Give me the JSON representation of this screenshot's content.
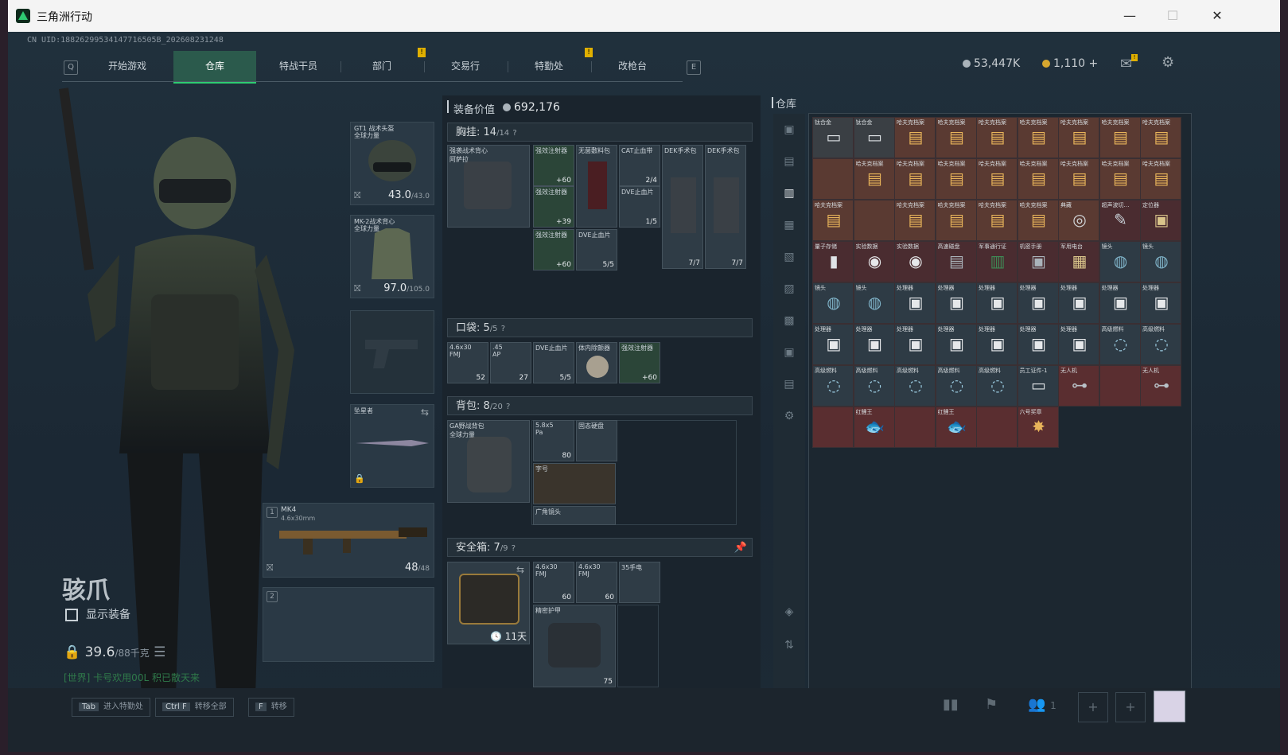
{
  "window": {
    "title": "三角洲行动",
    "min": "—",
    "max": "☐",
    "close": "✕"
  },
  "uid": "CN UID:18826299534147716505B_202608231248",
  "nav": {
    "left_key": "Q",
    "right_key": "E",
    "tabs": [
      "开始游戏",
      "仓库",
      "特战干员",
      "部门",
      "交易行",
      "特勤处",
      "改枪台"
    ],
    "active": 1,
    "badge": "!"
  },
  "currency": {
    "silver": "53,447K",
    "gold": "1,110",
    "plus": "+"
  },
  "operator": {
    "name": "骇爪",
    "show_equipment": "显示装备",
    "weight": "39.6",
    "weight_max": "/88千克",
    "chat": "[世界] 卡号欢用00L 积已散天来"
  },
  "equip": {
    "helmet": {
      "label": "GT1 战术头盔\n全球力量",
      "val": "43.0",
      "max": "/43.0"
    },
    "armor": {
      "label": "MK-2战术背心\n全球力量",
      "val": "97.0",
      "max": "/105.0"
    },
    "melee": {
      "label": "坠星者"
    },
    "primary": {
      "num": "1",
      "label": "MK4",
      "sub": "4.6x30mm",
      "val": "48",
      "max": "/48"
    },
    "secondary": {
      "num": "2"
    }
  },
  "mid": {
    "value_label": "装备价值",
    "value": "692,176",
    "chest": {
      "label": "胸挂:",
      "count": "14",
      "max": "/14",
      "help": "?"
    },
    "pockets": {
      "label": "口袋:",
      "count": "5",
      "max": "/5",
      "help": "?"
    },
    "backpack": {
      "label": "背包:",
      "count": "8",
      "max": "/20",
      "help": "?"
    },
    "safe": {
      "label": "安全箱:",
      "count": "7",
      "max": "/9",
      "help": "?",
      "days": "11天"
    },
    "chest_items": [
      {
        "l": "强袭战术背心\n阿萨拉",
        "n": ""
      },
      {
        "l": "强效注射器",
        "n": "+60"
      },
      {
        "l": "无菌敷料包",
        "n": ""
      },
      {
        "l": "CAT止血带",
        "n": "2/4"
      },
      {
        "l": "DEK手术包",
        "n": "7/7"
      },
      {
        "l": "DEK手术包",
        "n": "7/7"
      },
      {
        "l": "强效注射器",
        "n": "+39"
      },
      {
        "l": "DVE止血片",
        "n": "1/5"
      },
      {
        "l": "强效注射器",
        "n": "+60"
      },
      {
        "l": "DVE止血片",
        "n": "5/5"
      }
    ],
    "pocket_items": [
      {
        "l": "4.6x30\nFMJ",
        "n": "52"
      },
      {
        "l": ".45\nAP",
        "n": "27"
      },
      {
        "l": "DVE止血片",
        "n": "5/5"
      },
      {
        "l": "体内除颤器",
        "n": ""
      },
      {
        "l": "强效注射器",
        "n": "+60"
      }
    ],
    "backpack_items": [
      {
        "l": "GA野战背包\n全球力量",
        "n": ""
      },
      {
        "l": "5.8x5\nPa",
        "n": "80"
      },
      {
        "l": "固态硬盘",
        "n": ""
      },
      {
        "l": "字号",
        "n": ""
      },
      {
        "l": "广角镜头",
        "n": ""
      }
    ],
    "safe_items": [
      {
        "l": "4.6x30\nFMJ",
        "n": "60"
      },
      {
        "l": "4.6x30\nFMJ",
        "n": "60"
      },
      {
        "l": "35手电",
        "n": ""
      },
      {
        "l": "精密护甲",
        "n": "75"
      }
    ]
  },
  "storage": {
    "label": "仓库",
    "items": [
      {
        "l": "钛合金",
        "s": "▭",
        "c": "#3a3f44",
        "t": "#dfe3e6"
      },
      {
        "l": "钛合金",
        "s": "▭",
        "c": "#3a3f44",
        "t": "#dfe3e6"
      },
      {
        "l": "哈夫克档案",
        "s": "▤",
        "c": "#5a3a32",
        "t": "#e8b45a"
      },
      {
        "l": "哈夫克档案",
        "s": "▤",
        "c": "#5a3a32",
        "t": "#e8b45a"
      },
      {
        "l": "哈夫克档案",
        "s": "▤",
        "c": "#5a3a32",
        "t": "#e8b45a"
      },
      {
        "l": "哈夫克档案",
        "s": "▤",
        "c": "#5a3a32",
        "t": "#e8b45a"
      },
      {
        "l": "哈夫克档案",
        "s": "▤",
        "c": "#5a3a32",
        "t": "#e8b45a"
      },
      {
        "l": "哈夫克档案",
        "s": "▤",
        "c": "#5a3a32",
        "t": "#e8b45a"
      },
      {
        "l": "哈夫克档案",
        "s": "▤",
        "c": "#5a3a32",
        "t": "#e8b45a"
      },
      {
        "l": "",
        "s": "",
        "c": "#5a3a32",
        "t": "#e8b45a"
      },
      {
        "l": "哈夫克档案",
        "s": "▤",
        "c": "#5a3a32",
        "t": "#e8b45a"
      },
      {
        "l": "哈夫克档案",
        "s": "▤",
        "c": "#5a3a32",
        "t": "#e8b45a"
      },
      {
        "l": "哈夫克档案",
        "s": "▤",
        "c": "#5a3a32",
        "t": "#e8b45a"
      },
      {
        "l": "哈夫克档案",
        "s": "▤",
        "c": "#5a3a32",
        "t": "#e8b45a"
      },
      {
        "l": "哈夫克档案",
        "s": "▤",
        "c": "#5a3a32",
        "t": "#e8b45a"
      },
      {
        "l": "哈夫克档案",
        "s": "▤",
        "c": "#5a3a32",
        "t": "#e8b45a"
      },
      {
        "l": "哈夫克档案",
        "s": "▤",
        "c": "#5a3a32",
        "t": "#e8b45a"
      },
      {
        "l": "哈夫克档案",
        "s": "▤",
        "c": "#5a3a32",
        "t": "#e8b45a"
      },
      {
        "l": "哈夫克档案",
        "s": "▤",
        "c": "#5a3a32",
        "t": "#e8b45a"
      },
      {
        "l": "",
        "s": "",
        "c": "#5a3a32",
        "t": "#e8b45a"
      },
      {
        "l": "哈夫克档案",
        "s": "▤",
        "c": "#5a3a32",
        "t": "#e8b45a"
      },
      {
        "l": "哈夫克档案",
        "s": "▤",
        "c": "#5a3a32",
        "t": "#e8b45a"
      },
      {
        "l": "哈夫克档案",
        "s": "▤",
        "c": "#5a3a32",
        "t": "#e8b45a"
      },
      {
        "l": "哈夫克档案",
        "s": "▤",
        "c": "#5a3a32",
        "t": "#e8b45a"
      },
      {
        "l": "典藏",
        "s": "◎",
        "c": "#5a3a32",
        "t": "#d5dadd"
      },
      {
        "l": "超声波切…",
        "s": "✎",
        "c": "#4a2c30",
        "t": "#c9d1d7"
      },
      {
        "l": "定位器",
        "s": "▣",
        "c": "#4a2c30",
        "t": "#d9c48a"
      },
      {
        "l": "量子存储",
        "s": "▮",
        "c": "#4a2c30",
        "t": "#dfe3e6"
      },
      {
        "l": "实验数据",
        "s": "◉",
        "c": "#4a2c30",
        "t": "#e6e8ea"
      },
      {
        "l": "实验数据",
        "s": "◉",
        "c": "#4a2c30",
        "t": "#e6e8ea"
      },
      {
        "l": "高速磁盘",
        "s": "▤",
        "c": "#4a2c30",
        "t": "#aab3ba"
      },
      {
        "l": "军事通行证",
        "s": "▥",
        "c": "#4a2c30",
        "t": "#3f8a55"
      },
      {
        "l": "机密手册",
        "s": "▣",
        "c": "#4a2c30",
        "t": "#aab3ba"
      },
      {
        "l": "军用电台",
        "s": "▦",
        "c": "#4a2c30",
        "t": "#d9c48a"
      },
      {
        "l": "镜头",
        "s": "◍",
        "c": "#2e3b45",
        "t": "#7fb3c8"
      },
      {
        "l": "镜头",
        "s": "◍",
        "c": "#2e3b45",
        "t": "#7fb3c8"
      },
      {
        "l": "镜头",
        "s": "◍",
        "c": "#2e3b45",
        "t": "#7fb3c8"
      },
      {
        "l": "镜头",
        "s": "◍",
        "c": "#2e3b45",
        "t": "#7fb3c8"
      },
      {
        "l": "处理器",
        "s": "▣",
        "c": "#2e3b45",
        "t": "#e6e8ea"
      },
      {
        "l": "处理器",
        "s": "▣",
        "c": "#2e3b45",
        "t": "#e6e8ea"
      },
      {
        "l": "处理器",
        "s": "▣",
        "c": "#2e3b45",
        "t": "#e6e8ea"
      },
      {
        "l": "处理器",
        "s": "▣",
        "c": "#2e3b45",
        "t": "#e6e8ea"
      },
      {
        "l": "处理器",
        "s": "▣",
        "c": "#2e3b45",
        "t": "#e6e8ea"
      },
      {
        "l": "处理器",
        "s": "▣",
        "c": "#2e3b45",
        "t": "#e6e8ea"
      },
      {
        "l": "处理器",
        "s": "▣",
        "c": "#2e3b45",
        "t": "#e6e8ea"
      },
      {
        "l": "处理器",
        "s": "▣",
        "c": "#2e3b45",
        "t": "#e6e8ea"
      },
      {
        "l": "处理器",
        "s": "▣",
        "c": "#2e3b45",
        "t": "#e6e8ea"
      },
      {
        "l": "处理器",
        "s": "▣",
        "c": "#2e3b45",
        "t": "#e6e8ea"
      },
      {
        "l": "处理器",
        "s": "▣",
        "c": "#2e3b45",
        "t": "#e6e8ea"
      },
      {
        "l": "处理器",
        "s": "▣",
        "c": "#2e3b45",
        "t": "#e6e8ea"
      },
      {
        "l": "处理器",
        "s": "▣",
        "c": "#2e3b45",
        "t": "#e6e8ea"
      },
      {
        "l": "处理器",
        "s": "▣",
        "c": "#2e3b45",
        "t": "#e6e8ea"
      },
      {
        "l": "高级燃料",
        "s": "◌",
        "c": "#2e3b45",
        "t": "#9fd0e6"
      },
      {
        "l": "高级燃料",
        "s": "◌",
        "c": "#2e3b45",
        "t": "#9fd0e6"
      },
      {
        "l": "高级燃料",
        "s": "◌",
        "c": "#2e3b45",
        "t": "#9fd0e6"
      },
      {
        "l": "高级燃料",
        "s": "◌",
        "c": "#2e3b45",
        "t": "#9fd0e6"
      },
      {
        "l": "高级燃料",
        "s": "◌",
        "c": "#2e3b45",
        "t": "#9fd0e6"
      },
      {
        "l": "高级燃料",
        "s": "◌",
        "c": "#2e3b45",
        "t": "#9fd0e6"
      },
      {
        "l": "高级燃料",
        "s": "◌",
        "c": "#2e3b45",
        "t": "#9fd0e6"
      },
      {
        "l": "员工证件-1",
        "s": "▭",
        "c": "#2e3b45",
        "t": "#dfe3e6"
      },
      {
        "l": "无人机",
        "s": "⊶",
        "c": "#5a2e30",
        "t": "#b8c0c6"
      },
      {
        "l": "",
        "s": "",
        "c": "#5a2e30",
        "t": "#b8c0c6"
      },
      {
        "l": "无人机",
        "s": "⊶",
        "c": "#5a2e30",
        "t": "#b8c0c6"
      },
      {
        "l": "",
        "s": "",
        "c": "#5a2e30",
        "t": "#b8c0c6"
      },
      {
        "l": "红鲤王",
        "s": "🐟",
        "c": "#5a2e30",
        "t": "#ff7a5a"
      },
      {
        "l": "",
        "s": "",
        "c": "#5a2e30",
        "t": "#ff7a5a"
      },
      {
        "l": "红鲤王",
        "s": "🐟",
        "c": "#5a2e30",
        "t": "#ff7a5a"
      },
      {
        "l": "",
        "s": "",
        "c": "#5a2e30",
        "t": "#ff7a5a"
      },
      {
        "l": "六号奖章",
        "s": "✸",
        "c": "#5a2e30",
        "t": "#e8b45a"
      }
    ]
  },
  "bottom": {
    "hints": [
      {
        "key": "Tab",
        "label": "进入特勤处"
      },
      {
        "key": "Ctrl F",
        "label": "转移全部"
      },
      {
        "key": "F",
        "label": "转移"
      }
    ],
    "friends": "1"
  }
}
